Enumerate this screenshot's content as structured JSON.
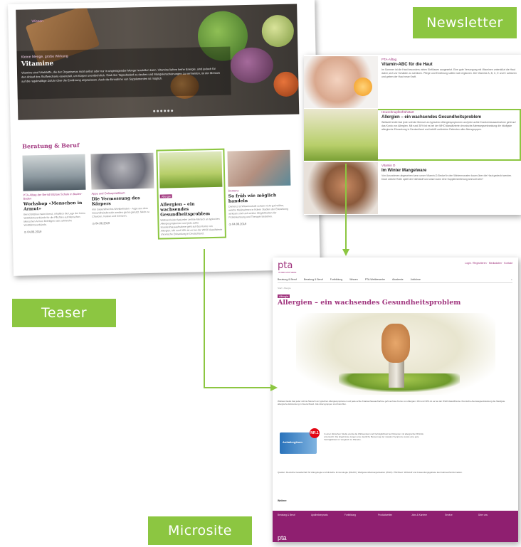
{
  "labels": {
    "newsletter": "Newsletter",
    "teaser": "Teaser",
    "microsite": "Microsite"
  },
  "colors": {
    "accent_green": "#8cc641",
    "brand_purple": "#a0357e",
    "footer_purple": "#8f1f70"
  },
  "teaser": {
    "hero": {
      "label": "Wissen",
      "kicker": "Kleine Menge, große Wirkung",
      "title": "Vitamine",
      "text": "Vitamine sind Vitalstoffe, die der Organismus nicht selbst oder nur in ungenügender Menge herstellen kann. Vitamine liefern keine Energie, sind jedoch für den Ablauf des Stoffwechsels essenziell, um Körper unentbehrlich. Sind den Tagesbedarf zu decken und Mangelerscheinungen zu vermeiden, ist der Mensch auf die regelmäßige Zufuhr über die Ernährung angewiesen. Auch die Einnahme von Supplementen ist möglich."
    },
    "section_title": "Beratung & Beruf",
    "cards": [
      {
        "kicker": "PTA-Alltag der Bernd Bitzlow Schule in Baden-Baden",
        "title": "Workshop «Menschen in Armut»",
        "text": "Bernd Bitzlow meint Armut, inhaltlich die Lage der freien Wohlfahrtsverbände für die Pflichten auf Menschen Menschen Armut. Beteiligen sich zahlreiche Wohlfahrtsverbände.",
        "date": "04.06.2019"
      },
      {
        "kicker": "Apps und Onlinepraktikum",
        "title": "Die Vermessung des Körpers",
        "text": "Von Gesundheit bis Wohlbefinden – Apps aus dem Gesundheitsbereich werden gerne genutzt. Mehr zu Chancen, Nutzen und Grenzen.",
        "date": "04.06.2019"
      },
      {
        "kicker": "Allergie",
        "title": "Allergien – ein wachsendes Gesundheitsproblem",
        "text": "Weltweit leidet fast jeder zehnte Mensch an typischen Allergiesymptomen und jede achte Krankenhausaufnahme geht auf das Konto von Allergien. Mit rund 30% ist es bei der WHO klassifizierte chronische Erkrankung in Deutschland.",
        "date": ""
      },
      {
        "kicker": "Demenz",
        "title": "So früh wie möglich handeln",
        "text": "Demenz ist Wissenschaft schwer nicht gut heilbar, welche Maßnahmen in frühen Stadien der Erkrankung wirksam sind und welche Möglichkeiten der Früherkennung und Therapie bestehen.",
        "date": "04.06.2019"
      }
    ]
  },
  "newsletter": {
    "items": [
      {
        "kicker": "PTA-Alltag",
        "title": "Vitamin-ABC für die Haut",
        "text": "Im Sommer ist die Haut besonders vielen Einflüssen ausgesetzt. Eine gute Versorgung mit Vitaminen unterstützt die Haut dabei, sich vor Schäden zu schützen. Pflege und Ernährung sollten sich ergänzen. Die Vitamine A, B, C, E und K schützen und geben der Haut neue Kraft."
      },
      {
        "kicker": "Heuschnupfenfrühstart",
        "title": "Allergien – ein wachsendes Gesundheitsproblem",
        "text": "Weltweit leidet fast jeder zehnte Mensch an typischen Allergiesymptomen und jede achte Krankenhausaufnahme geht auf das Konto von Allergien. Mit rund 30% ist es bei der WHO klassifizierte chronische Atemwegserkrankung die häufigste allergische Erkrankung in Deutschland und betrifft zahlreiche Patienten aller Altersgruppen."
      },
      {
        "kicker": "Vitamin D",
        "title": "Im Winter Mangelware",
        "text": "Von Ausnahmen abgesehen kann unser Vitamin-D-Bedarf in den Wintermonaten kaum über die Haut gedeckt werden. Doch welche Rolle spielt der Nährstoff und wann kann eine Supplementierung sinnvoll sein?"
      }
    ]
  },
  "microsite": {
    "logo": "pta",
    "logo_sub": "IN DER APOTHEKE",
    "top_links": "Login / Registrieren · Mediadaten · Kontakt",
    "nav": [
      "Beratung & Beruf",
      "Beratung & Beruf",
      "Fortbildung",
      "Wissen",
      "PTA-Wettbewerbe",
      "Akademie",
      "Jobbörse",
      "Stellenmarkt"
    ],
    "breadcrumb": "Start / Allergie",
    "kicker": "Allergie",
    "title": "Allergien – ein wachsendes Gesundheitsproblem",
    "intro": "Weltweit leidet fast jeder zehnte Mensch an typischen Allergiesymptomen und jede achte Krankenhausaufnahme geht auf das Konto von Allergien. Mit rund 30% ist es bei der WHO klassifizierte chronische Atemwegserkrankung die häufigste allergische Erkrankung in Deutschland. Alle Altersgruppen sind betroffen.",
    "body": "In einer klinischen Studie wurde die Wirksamkeit und Verträglichkeit bei Patienten mit allergischer Rhinitis untersucht. Die Ergebnisse zeigen eine deutliche Besserung der nasalen Symptome sowie eine gute Verträglichkeit im Vergleich zu Placebo.",
    "product_badge": "NR.1",
    "product_name": "Antiallergikum",
    "footnote": "Quellen: Deutsche Gesellschaft für Allergologie und klinische Immunologie (DGAKI); Weltgesundheitsorganisation (WHO). Pflichttext: Wirkstoff und Anwendungsgebiete laut Gebrauchsinformation.",
    "mehr": "Weitere",
    "footer_cols": [
      "Beratung & Beruf",
      "Apothekenpraxis",
      "Fortbildung",
      "Produktwelten",
      "Jobs & Karriere",
      "Service",
      "Über uns"
    ],
    "footer_logo": "pta"
  }
}
